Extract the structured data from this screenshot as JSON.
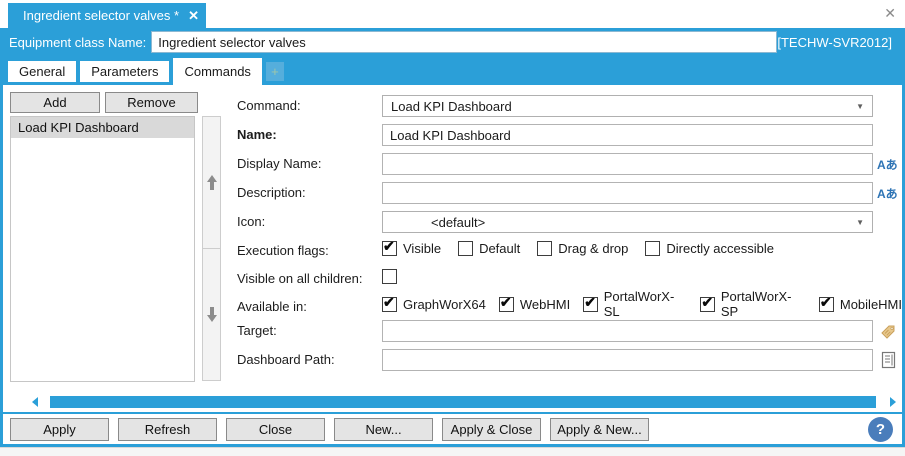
{
  "window": {
    "close_icon": "✕"
  },
  "document_tab": {
    "title": "Ingredient selector valves *",
    "close_icon": "✕"
  },
  "header": {
    "label": "Equipment class Name:",
    "value": "Ingredient selector valves",
    "server_badge": "[TECHW-SVR2012]"
  },
  "tab_strip": {
    "tabs": [
      {
        "label": "General"
      },
      {
        "label": "Parameters"
      },
      {
        "label": "Commands"
      }
    ],
    "active_tab": "Commands",
    "add_tab_label": "+"
  },
  "command_list": {
    "add_button": "Add",
    "remove_button": "Remove",
    "items": [
      "Load KPI Dashboard"
    ],
    "selected_item": "Load KPI Dashboard"
  },
  "form": {
    "command": {
      "label": "Command:",
      "value": "Load KPI Dashboard"
    },
    "name": {
      "label": "Name:",
      "value": "Load KPI Dashboard"
    },
    "display_name": {
      "label": "Display Name:",
      "value": ""
    },
    "description": {
      "label": "Description:",
      "value": ""
    },
    "icon": {
      "label": "Icon:",
      "value": "<default>"
    },
    "execution_flags": {
      "label": "Execution flags:",
      "options": [
        {
          "label": "Visible",
          "checked": true
        },
        {
          "label": "Default",
          "checked": false
        },
        {
          "label": "Drag & drop",
          "checked": false
        },
        {
          "label": "Directly accessible",
          "checked": false
        }
      ]
    },
    "visible_all_children": {
      "label": "Visible on all children:",
      "checked": false
    },
    "available_in": {
      "label": "Available in:",
      "options": [
        {
          "label": "GraphWorX64",
          "checked": true
        },
        {
          "label": "WebHMI",
          "checked": true
        },
        {
          "label": "PortalWorX-SL",
          "checked": true
        },
        {
          "label": "PortalWorX-SP",
          "checked": true
        },
        {
          "label": "MobileHMI",
          "checked": true
        }
      ]
    },
    "target": {
      "label": "Target:",
      "value": ""
    },
    "dashboard_path": {
      "label": "Dashboard Path:",
      "value": ""
    }
  },
  "icons": {
    "localize": "Aあ",
    "combo_arrow": "▼"
  },
  "footer": {
    "buttons": [
      "Apply",
      "Refresh",
      "Close",
      "New...",
      "Apply & Close",
      "Apply & New..."
    ],
    "help_icon": "?"
  }
}
